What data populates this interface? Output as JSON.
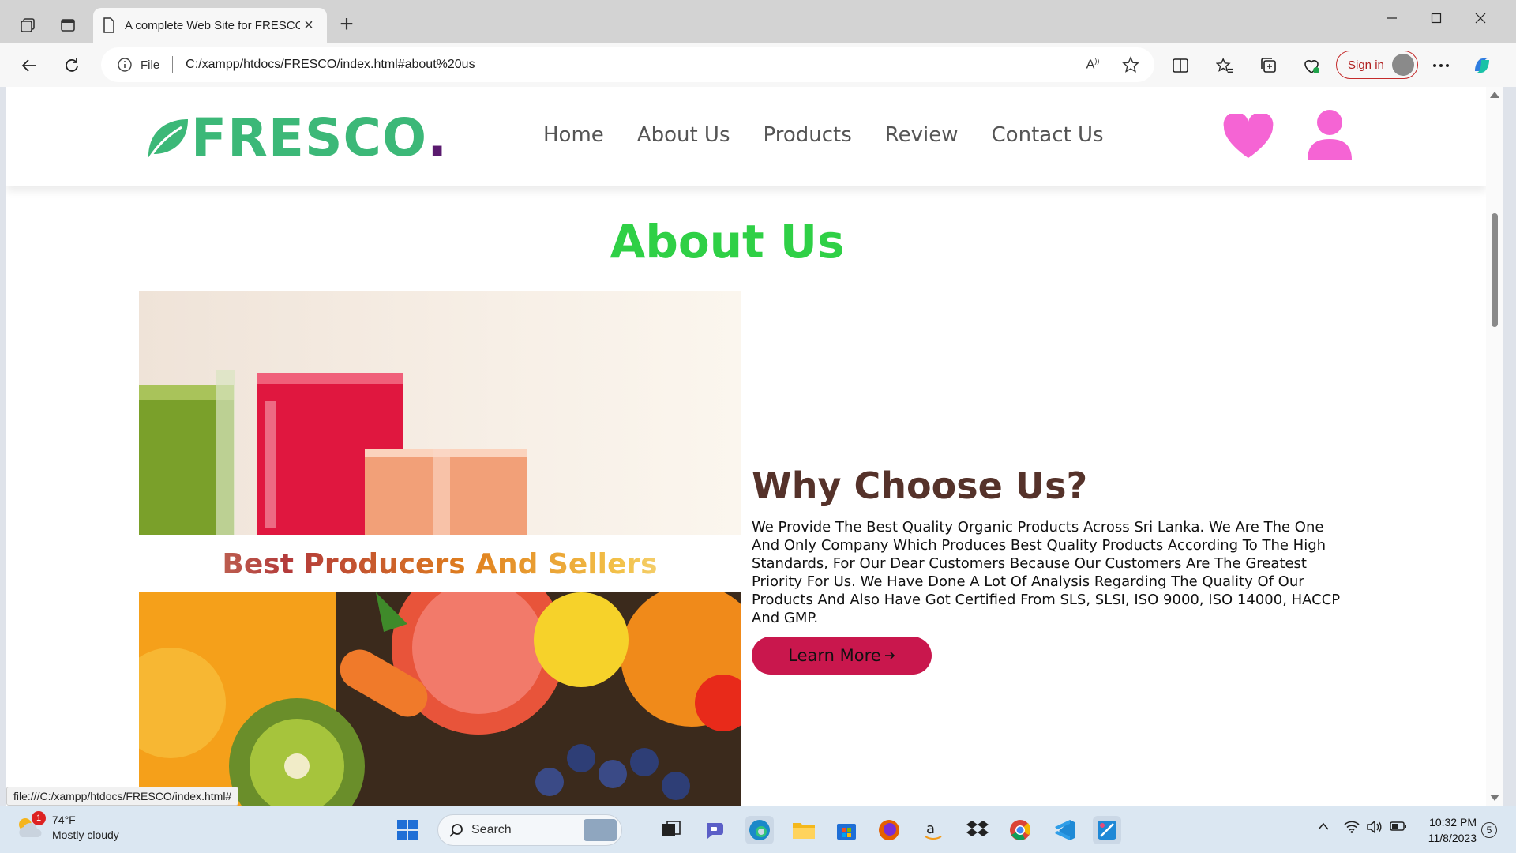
{
  "browser": {
    "tab_title": "A complete Web Site for FRESCO",
    "address_scheme": "File",
    "address_url": "C:/xampp/htdocs/FRESCO/index.html#about%20us",
    "sign_in_label": "Sign in",
    "status_url": "file:///C:/xampp/htdocs/FRESCO/index.html#"
  },
  "site": {
    "logo_text": "FRESCO",
    "logo_dot": ".",
    "nav": [
      "Home",
      "About Us",
      "Products",
      "Review",
      "Contact Us"
    ],
    "section_title": "About Us",
    "image_caption": "Best Producers And Sellers",
    "why_heading": "Why Choose Us?",
    "why_text": "We Provide The Best Quality Organic Products Across Sri Lanka. We Are The One And Only Company Which Produces Best Quality Products According To The High Standards, For Our Dear Customers Because Our Customers Are The Greatest Priority For Us. We Have Done A Lot Of Analysis Regarding The Quality Of Our Products And Also Have Got Certified From SLS, SLSI, ISO 9000, ISO 14000, HACCP And GMP.",
    "learn_more_label": "Learn More",
    "colors": {
      "logo_green": "#3cb878",
      "title_green": "#2fd046",
      "heading_brown": "#55322a",
      "button": "#c9174d",
      "icon_pink": "#f564d4"
    }
  },
  "taskbar": {
    "weather_temp": "74°F",
    "weather_desc": "Mostly cloudy",
    "weather_badge": "1",
    "search_label": "Search",
    "time": "10:32 PM",
    "date": "11/8/2023",
    "notification_count": "5"
  }
}
